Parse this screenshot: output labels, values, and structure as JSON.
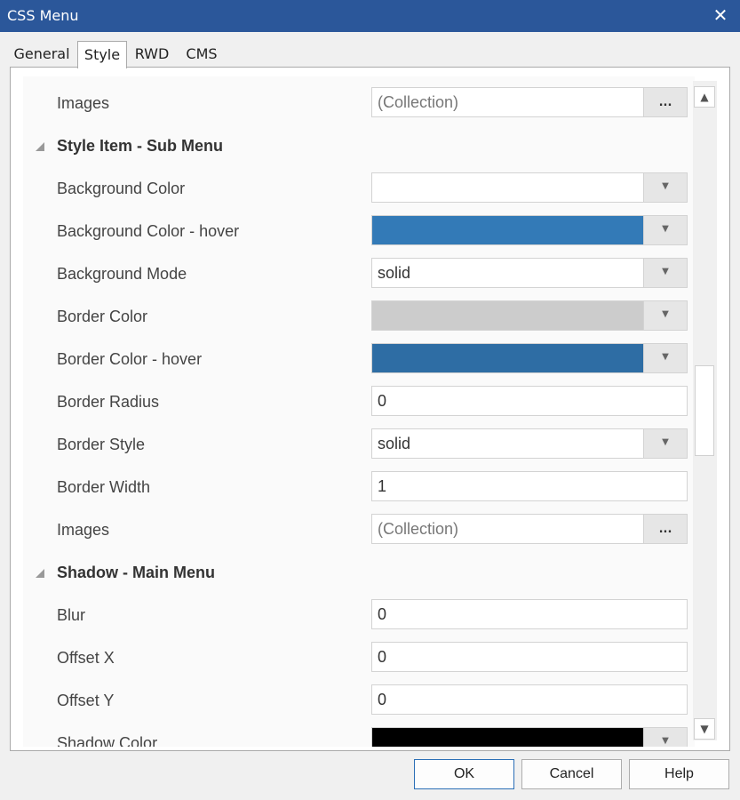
{
  "window": {
    "title": "CSS Menu",
    "close_glyph": "✕"
  },
  "tabs": [
    {
      "label": "General",
      "active": false
    },
    {
      "label": "Style",
      "active": true
    },
    {
      "label": "RWD",
      "active": false
    },
    {
      "label": "CMS",
      "active": false
    }
  ],
  "rows": [
    {
      "kind": "prop",
      "label": "Images",
      "control": "collection",
      "value": "(Collection)"
    },
    {
      "kind": "category",
      "label": "Style Item - Sub Menu"
    },
    {
      "kind": "prop",
      "label": "Background Color",
      "control": "color",
      "color": "#ffffff"
    },
    {
      "kind": "prop",
      "label": "Background Color - hover",
      "control": "color",
      "color": "#337ab7"
    },
    {
      "kind": "prop",
      "label": "Background Mode",
      "control": "dropdown",
      "value": "solid"
    },
    {
      "kind": "prop",
      "label": "Border Color",
      "control": "color",
      "color": "#cccccc"
    },
    {
      "kind": "prop",
      "label": "Border Color - hover",
      "control": "color",
      "color": "#2e6da4"
    },
    {
      "kind": "prop",
      "label": "Border Radius",
      "control": "text",
      "value": "0"
    },
    {
      "kind": "prop",
      "label": "Border Style",
      "control": "dropdown",
      "value": "solid"
    },
    {
      "kind": "prop",
      "label": "Border Width",
      "control": "text",
      "value": "1"
    },
    {
      "kind": "prop",
      "label": "Images",
      "control": "collection",
      "value": "(Collection)"
    },
    {
      "kind": "category",
      "label": "Shadow - Main Menu"
    },
    {
      "kind": "prop",
      "label": "Blur",
      "control": "text",
      "value": "0"
    },
    {
      "kind": "prop",
      "label": "Offset X",
      "control": "text",
      "value": "0"
    },
    {
      "kind": "prop",
      "label": "Offset Y",
      "control": "text",
      "value": "0"
    },
    {
      "kind": "prop",
      "label": "Shadow Color",
      "control": "color",
      "color": "#000000"
    }
  ],
  "glyphs": {
    "dropdown": "▼",
    "ellipsis": "...",
    "scroll_up": "▲",
    "scroll_down": "▼"
  },
  "buttons": {
    "ok": "OK",
    "cancel": "Cancel",
    "help": "Help"
  }
}
